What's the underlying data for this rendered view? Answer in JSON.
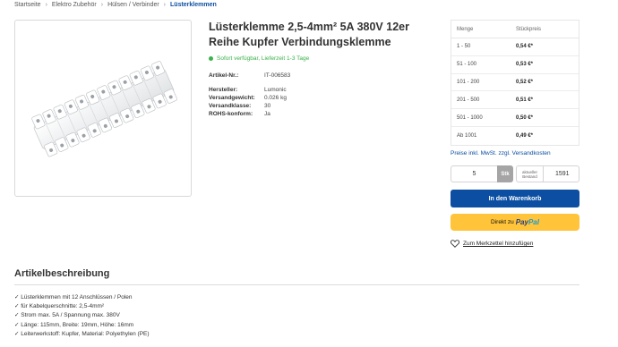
{
  "breadcrumb": [
    "Startseite",
    "Elektro Zubehör",
    "Hülsen / Verbinder",
    "Lüsterklemmen"
  ],
  "product": {
    "title": "Lüsterklemme 2,5-4mm² 5A 380V 12er Reihe Kupfer Verbindungsklemme",
    "availability": "Sofort verfügbar, Lieferzeit 1-3 Tage",
    "sku_label": "Artikel-Nr.:",
    "sku": "IT-006583",
    "properties": [
      {
        "label": "Hersteller:",
        "value": "Lumonic"
      },
      {
        "label": "Versandgewicht:",
        "value": "0.026 kg"
      },
      {
        "label": "Versandklasse:",
        "value": "30"
      },
      {
        "label": "ROHS-konform:",
        "value": "Ja"
      }
    ]
  },
  "price_table": {
    "header_qty": "Menge",
    "header_price": "Stückpreis",
    "rows": [
      {
        "qty": "1 - 50",
        "price": "0,54 €*"
      },
      {
        "qty": "51 - 100",
        "price": "0,53 €*"
      },
      {
        "qty": "101 - 200",
        "price": "0,52 €*"
      },
      {
        "qty": "201 - 500",
        "price": "0,51 €*"
      },
      {
        "qty": "501 - 1000",
        "price": "0,50 €*"
      },
      {
        "qty": "Ab 1001",
        "price": "0,49 €*"
      }
    ]
  },
  "tax_note": "Preise inkl. MwSt. zzgl. Versandkosten",
  "purchase": {
    "quantity": "5",
    "unit": "Stk",
    "stock_label": "aktueller Bestand",
    "stock_value": "1591",
    "cart_button": "In den Warenkorb",
    "paypal_prefix": "Direkt zu",
    "paypal_brand_1": "Pay",
    "paypal_brand_2": "Pal",
    "wishlist": "Zum Merkzettel hinzufügen"
  },
  "description": {
    "title": "Artikelbeschreibung",
    "items": [
      "✓ Lüsterklemmen mit 12 Anschlüssen / Polen",
      "✓ für Kabelquerschnitte: 2,5-4mm²",
      "✓ Strom max. 5A / Spannung max. 380V",
      "✓ Länge: 115mm, Breite: 19mm, Höhe: 16mm",
      "✓ Leiterwerkstoff: Kupfer, Material: Polyethylen (PE)"
    ]
  },
  "colors": {
    "primary": "#0b4ea2",
    "available": "#3bb24a",
    "paypal": "#ffc439"
  }
}
